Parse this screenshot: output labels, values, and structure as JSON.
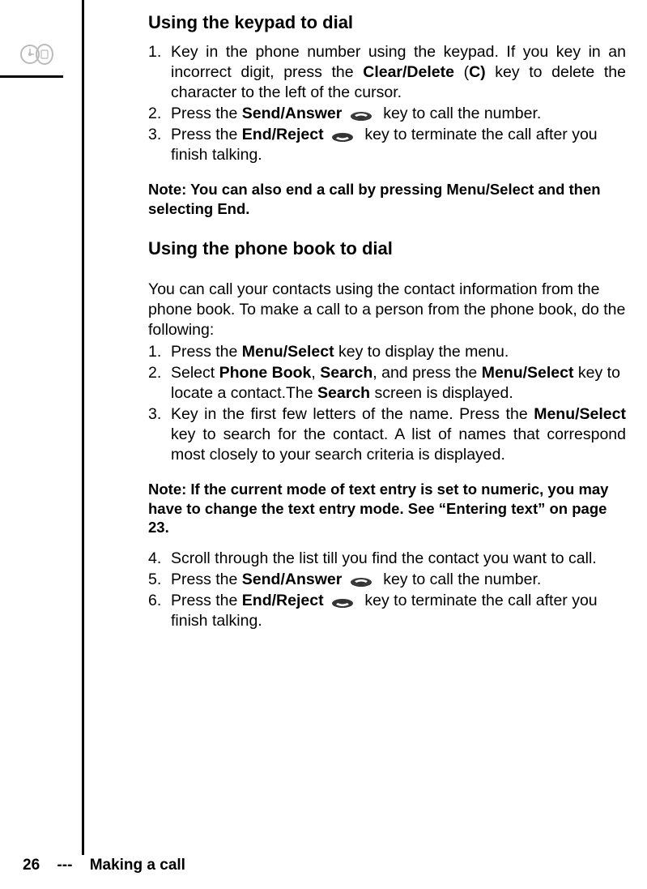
{
  "heading1": "Using the keypad to dial",
  "s1": {
    "i1": {
      "n": "1.",
      "a": "Key in the phone number using the keypad. If you key in an incorrect digit, press the ",
      "b": "Clear/Delete",
      "c": " (",
      "d": "C)",
      "e": " key to delete the character to the left of the cursor."
    },
    "i2": {
      "n": "2.",
      "a": "Press the ",
      "b": "Send/Answer",
      "c": " key to call the number."
    },
    "i3": {
      "n": "3.",
      "a": "Press the ",
      "b": "End/Reject",
      "c": " key to terminate the call after you finish talking."
    }
  },
  "note1": "Note: You can also end a call by pressing Menu/Select and then selecting End.",
  "heading2": "Using the phone book to dial",
  "intro": "You can call your contacts using the contact information from the phone book. To make a call to a person from the phone book, do the following:",
  "s2": {
    "i1": {
      "n": "1.",
      "a": "Press the ",
      "b": "Menu/Select",
      "c": " key to display the menu."
    },
    "i2": {
      "n": "2.",
      "a": "Select ",
      "b": "Phone Book",
      "c": ", ",
      "d": "Search",
      "e": ", and press the ",
      "f": "Menu/Select",
      "g": " key to locate a contact.The ",
      "h": "Search",
      "i": " screen is displayed."
    },
    "i3": {
      "n": "3.",
      "a": "Key in the first few letters of the name. Press the ",
      "b": "Menu/Select",
      "c": " key to search for the contact. A list of names that correspond most closely to your search criteria is displayed."
    }
  },
  "note2": "Note: If the current mode of text entry is set to numeric, you may have to change the text entry mode. See “Entering text” on page 23.",
  "s3": {
    "i4": {
      "n": "4.",
      "a": "Scroll through the list till you find the contact you want to call."
    },
    "i5": {
      "n": "5.",
      "a": "Press the ",
      "b": "Send/Answer",
      "c": " key to call the number."
    },
    "i6": {
      "n": "6.",
      "a": "Press the ",
      "b": "End/Reject",
      "c": " key to terminate the call after you finish talking."
    }
  },
  "footer": {
    "page": "26",
    "sep": "---",
    "title": "Making a call"
  }
}
